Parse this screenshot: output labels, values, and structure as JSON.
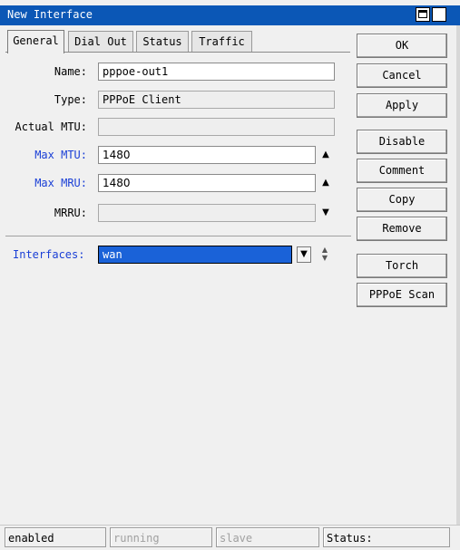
{
  "window": {
    "title": "New Interface"
  },
  "tabs": [
    "General",
    "Dial Out",
    "Status",
    "Traffic"
  ],
  "form": {
    "name_label": "Name:",
    "name_value": "pppoe-out1",
    "type_label": "Type:",
    "type_value": "PPPoE Client",
    "actual_mtu_label": "Actual MTU:",
    "actual_mtu_value": "",
    "max_mtu_label": "Max MTU:",
    "max_mtu_value": "1480",
    "max_mru_label": "Max MRU:",
    "max_mru_value": "1480",
    "mrru_label": "MRRU:",
    "mrru_value": "",
    "interfaces_label": "Interfaces:",
    "interfaces_value": "wan"
  },
  "buttons": [
    "OK",
    "Cancel",
    "Apply",
    "Disable",
    "Comment",
    "Copy",
    "Remove",
    "Torch",
    "PPPoE Scan"
  ],
  "status": {
    "enabled": "enabled",
    "running": "running",
    "slave": "slave",
    "status_label": "Status:"
  },
  "icons": {
    "up": "▲",
    "down": "▼",
    "dropdown": "▼",
    "updown": "▲▼"
  },
  "colors": {
    "titlebar": "#0b57b6",
    "label_blue": "#1a3fd6",
    "selection": "#1a62d8"
  }
}
